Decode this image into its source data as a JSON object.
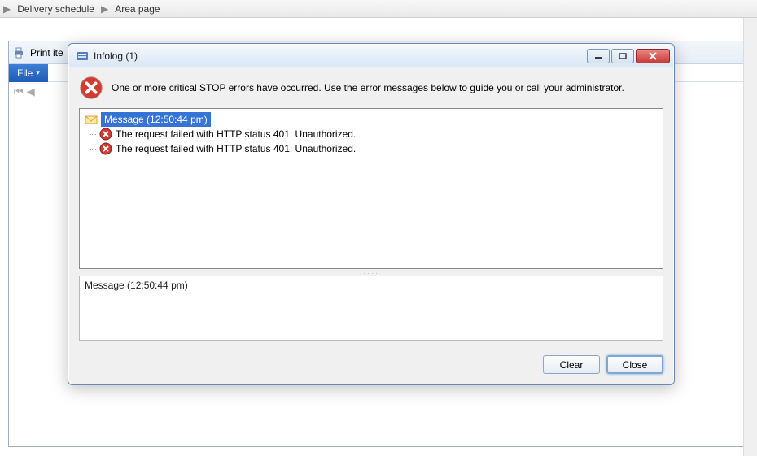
{
  "breadcrumb": {
    "item1": "Delivery schedule",
    "item2": "Area page"
  },
  "background": {
    "print_label": "Print ite",
    "file_label": "File"
  },
  "dialog": {
    "title": "Infolog (1)",
    "summary": "One or more critical STOP errors have occurred. Use the error messages below to guide you or call your administrator.",
    "tree": {
      "root_label": "Message (12:50:44 pm)",
      "items": [
        "The request failed with HTTP status 401: Unauthorized.",
        "The request failed with HTTP status 401: Unauthorized."
      ]
    },
    "detail_text": "Message (12:50:44 pm)",
    "buttons": {
      "clear": "Clear",
      "close": "Close"
    }
  }
}
